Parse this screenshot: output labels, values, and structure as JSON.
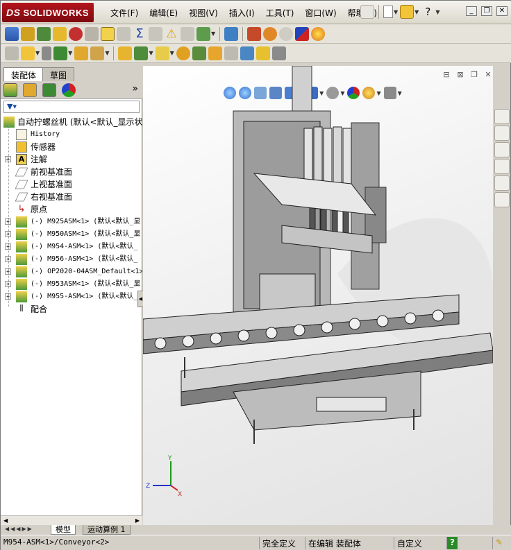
{
  "app": {
    "brand": "SOLIDWORKS",
    "brand_prefix": "DS"
  },
  "menu": {
    "items": [
      "文件(F)",
      "编辑(E)",
      "视图(V)",
      "插入(I)",
      "工具(T)",
      "窗口(W)",
      "帮助(H)"
    ]
  },
  "panel": {
    "tabs": [
      "装配体",
      "草图"
    ],
    "more": "»"
  },
  "tree": {
    "root": "自动拧螺丝机  (默认<默认_显示状",
    "items": [
      {
        "label": "History",
        "mono": true
      },
      {
        "label": "传感器"
      },
      {
        "label": "注解",
        "expand": "+"
      },
      {
        "label": "前视基准面"
      },
      {
        "label": "上视基准面"
      },
      {
        "label": "右视基准面"
      },
      {
        "label": "原点"
      }
    ],
    "components": [
      "(-) M925ASM<1> (默认<默认_显",
      "(-) M950ASM<1> (默认<默认_显",
      "(-) M954-ASM<1> (默认<默认_",
      "(-) M956-ASM<1> (默认<默认_",
      "(-) OP2020-04ASM_Default<1>",
      "(-) M953ASM<1> (默认<默认_显",
      "(-) M955-ASM<1> (默认<默认_"
    ],
    "mates": "配合"
  },
  "bottom_tabs": [
    "模型",
    "运动算例 1"
  ],
  "status": {
    "path": "M954-ASM<1>/Conveyor<2>",
    "defined": "完全定义",
    "editing": "在编辑 装配体",
    "custom": "自定义",
    "help": "?"
  },
  "colors": {
    "brand_red": "#b4141c",
    "chrome": "#d4d0c8",
    "model_gray": "#a8a8a8"
  }
}
